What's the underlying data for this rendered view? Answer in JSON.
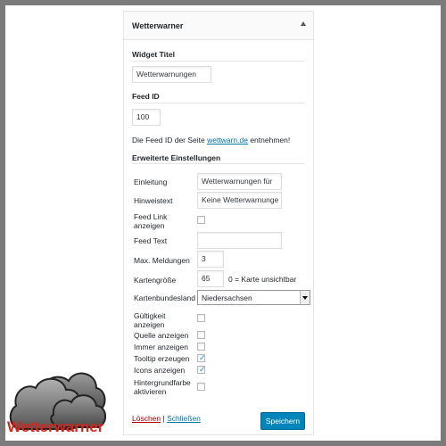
{
  "widget": {
    "title": "Wetterwarner"
  },
  "sections": {
    "widget_title_label": "Widget Titel",
    "widget_title_value": "Wetterwarnungen",
    "feed_id_label": "Feed ID",
    "feed_id_value": "100",
    "feed_hint_prefix": "Die Feed ID der Seite",
    "feed_hint_link": "wettwarn.de",
    "feed_hint_suffix": "entnehmen!",
    "advanced_label": "Erweiterte Einstellungen"
  },
  "fields": {
    "einleitung_label": "Einleitung",
    "einleitung_value": "Wetterwarnungen für",
    "hinweistext_label": "Hinweistext",
    "hinweistext_value": "Keine Wetterwarnunge",
    "feed_link_label": "Feed Link anzeigen",
    "feed_link_checked": false,
    "feed_text_label": "Feed Text",
    "feed_text_value": "",
    "max_label": "Max. Meldungen",
    "max_value": "3",
    "kartengroesse_label": "Kartengröße",
    "kartengroesse_value": "65",
    "kartengroesse_hint": "0 = Karte unsichtbar",
    "bundesland_label": "Kartenbundesland",
    "bundesland_value": "Niedersachsen",
    "gueltigkeit_label": "Gültigkeit anzeigen",
    "gueltigkeit_checked": false,
    "quelle_label": "Quelle anzeigen",
    "quelle_checked": false,
    "immer_label": "Immer anzeigen",
    "immer_checked": false,
    "tooltip_label": "Tooltip erzeugen",
    "tooltip_checked": true,
    "icons_label": "Icons anzeigen",
    "icons_checked": true,
    "hintergrund_label": "Hintergrundfarbe aktivieren",
    "hintergrund_checked": false
  },
  "footer": {
    "delete_label": "Löschen",
    "separator": "|",
    "close_label": "Schließen",
    "save_label": "Speichern"
  },
  "logo": {
    "text": "Wetterwarner",
    "icon": "cloud-icon"
  },
  "colors": {
    "primary_button": "#0085ba",
    "link": "#0073aa",
    "delete": "#aa0000",
    "logo_text": "#d5261c",
    "frame": "#7b7b7b"
  }
}
